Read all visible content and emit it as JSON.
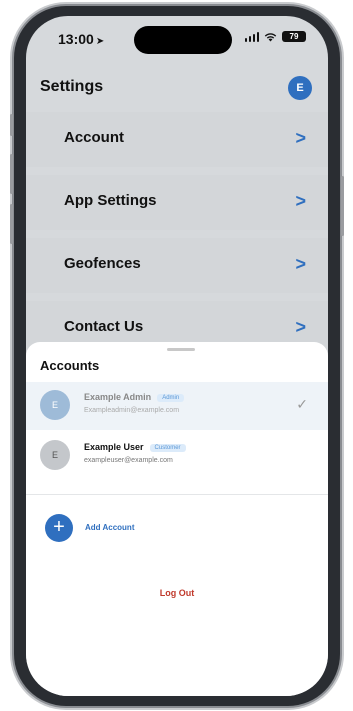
{
  "status_bar": {
    "time": "13:00",
    "battery": "79"
  },
  "header": {
    "title": "Settings",
    "avatar_initial": "E"
  },
  "menu": [
    {
      "label": "Account"
    },
    {
      "label": "App Settings"
    },
    {
      "label": "Geofences"
    },
    {
      "label": "Contact Us"
    }
  ],
  "accounts_sheet": {
    "title": "Accounts",
    "accounts": [
      {
        "initial": "E",
        "name": "Example Admin",
        "role": "Admin",
        "email": "Exampleadmin@example.com",
        "selected": true
      },
      {
        "initial": "E",
        "name": "Example User",
        "role": "Customer",
        "email": "exampleuser@example.com",
        "selected": false
      }
    ],
    "add_account_label": "Add Account",
    "logout_label": "Log Out"
  },
  "icons": {
    "time_arrow": "location-arrow-icon",
    "chevron": "chevron-right-icon",
    "check": "checkmark-icon",
    "add": "plus-icon"
  },
  "colors": {
    "accent": "#2f6fbf",
    "logout": "#c0392b",
    "badge_bg": "#dcebfa",
    "badge_text": "#5a97d6"
  }
}
